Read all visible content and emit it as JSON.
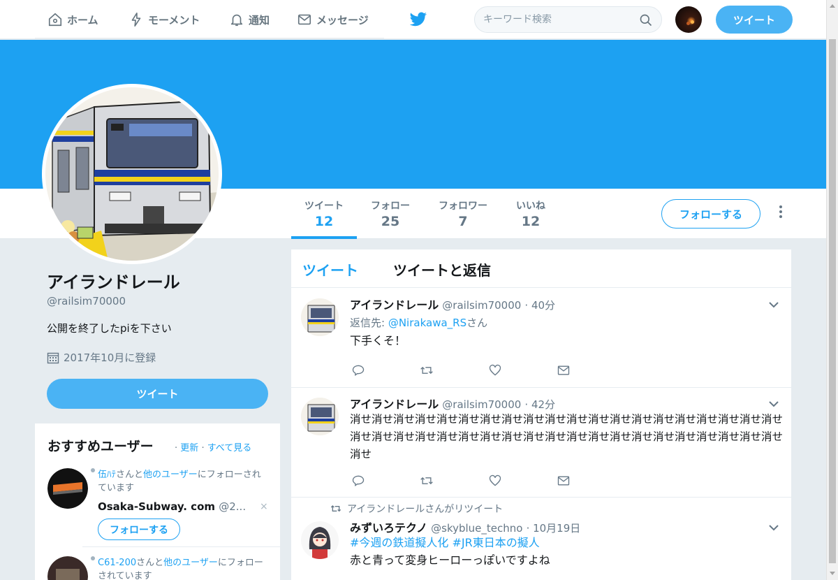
{
  "nav": {
    "home": "ホーム",
    "moments": "モーメント",
    "notifications": "通知",
    "messages": "メッセージ",
    "search_placeholder": "キーワード検索",
    "tweet_button": "ツイート"
  },
  "profile": {
    "name": "アイランドレール",
    "handle": "@railsim70000",
    "bio": "公開を終了したpiを下さい",
    "joined": "2017年10月に登録",
    "tweet_button": "ツイート",
    "follow_button": "フォローする",
    "stats": [
      {
        "label": "ツイート",
        "value": "12"
      },
      {
        "label": "フォロー",
        "value": "25"
      },
      {
        "label": "フォロワー",
        "value": "7"
      },
      {
        "label": "いいね",
        "value": "12"
      }
    ]
  },
  "who_to_follow": {
    "title": "おすすめユーザー",
    "refresh": "更新",
    "view_all": "すべて見る",
    "separator": "·",
    "users": [
      {
        "context_prefix": "伍ﾊﾃ",
        "context_mid": "さんと",
        "context_link": "他のユーザー",
        "context_suffix": "にフォローされています",
        "name": "Osaka-Subway. com",
        "handle": "@2...",
        "follow_label": "フォローする",
        "close": "×"
      },
      {
        "context_prefix": "C61-200",
        "context_mid": "さんと",
        "context_link": "他のユーザー",
        "context_suffix": "にフォローされています"
      }
    ]
  },
  "timeline": {
    "tabs": [
      "ツイート",
      "ツイートと返信"
    ],
    "tweets": [
      {
        "name": "アイランドレール",
        "handle": "@railsim70000",
        "time": "· 40分",
        "reply_prefix": "返信先: ",
        "reply_to": "@Nirakawa_RS",
        "reply_suffix": "さん",
        "text": "下手くそ！"
      },
      {
        "name": "アイランドレール",
        "handle": "@railsim70000",
        "time": "· 42分",
        "text": "消せ消せ消せ消せ消せ消せ消せ消せ消せ消せ消せ消せ消せ消せ消せ消せ消せ消せ消せ消せ消せ消せ消せ消せ消せ消せ消せ消せ消せ消せ消せ消せ消せ消せ消せ消せ消せ消せ消せ消せ消せ"
      },
      {
        "retweet_context": "アイランドレールさんがリツイート",
        "name": "みずいろテクノ",
        "handle": "@skyblue_techno",
        "time": "· 10月19日",
        "hashtags": "#今週の鉄道擬人化 #JR東日本の擬人",
        "text": "赤と青って変身ヒーローっぽいですよね"
      }
    ]
  },
  "colors": {
    "accent": "#1da1f2",
    "banner": "#1da1f2",
    "button": "#4ab3f4",
    "background": "#e6ecf0"
  }
}
